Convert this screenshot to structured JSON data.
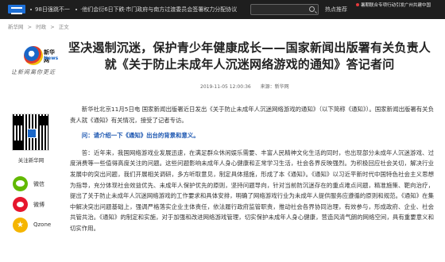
{
  "topbar": {
    "ticker": [
      "98日强跳不一",
      "·他们会衍6日下跌",
      "·市门政府与南方过渡委员会签署权力分配协议"
    ],
    "search_placeholder": "",
    "hot_label": "热点推荐",
    "hot_news": "暑期联合专项行动引发广州共建中国",
    "colors": {
      "bg": "#1e1e1e",
      "brand_blue": "#1d6fd6"
    }
  },
  "breadcrumb": [
    "新华网",
    ">",
    "时政",
    ">",
    "正文"
  ],
  "brand": {
    "name": "新华网",
    "subname": "News",
    "slogan": "让新闻离你更近"
  },
  "article": {
    "title": "坚决遏制沉迷，保护青少年健康成长——国家新闻出版署有关负责人就《关于防止未成年人沉迷网络游戏的通知》答记者问",
    "date": "2019-11-05 12:00:36",
    "source": "来源：新华网",
    "paragraphs": [
      "新华社北京11月5日电 国家新闻出版署近日发出《关于防止未成年人沉迷网络游戏的通知》（以下简称《通知》）。国家新闻出版署有关负责人就《通知》有关情况，接受了记者专访。",
      "问：请介绍一下《通知》出台的背景和意义。",
      "答：近年来，我国网络游戏业发展迅速，在满足群众休闲娱乐需要、丰富人民精神文化生活的同时，也出现部分未成年人沉迷游戏、过度消费等一些值得高度关注的问题。这些问题影响未成年人身心健康和正常学习生活，社会各界反映强烈。为积极回应社会关切，解决行业发展中的突出问题，我们开展相关调研，多方听取意见，制定具体措施，形成了本《通知》。《通知》以习近平新时代中国特色社会主义思想为指导，充分体现社会效益优先、未成年人保护优先的原则，坚持问题导向，针对当前防沉迷存在的重点难点问题，精准施策、靶向治疗，提出了关于防止未成年人沉迷网络游戏的工作要求和具体安排，明确了网络游戏行业为未成年人提供服务应遵循的原则和规范。《通知》在集中解决突出问题基础上，强调严格落实企业主体责任，依法履行政府监管职责，推动社会各界协同治理，有效参与，形成政府、企业、社会共管共治。《通知》的制定和实施，对于加强和改进网络游戏管理，切实保护未成年人身心健康，营造风清气朗的网络空间，具有重要意义和切实作用。"
    ],
    "question_color": "#1a55b0"
  },
  "social": {
    "qr_label": "关注新华网",
    "share": [
      {
        "label": "微信",
        "icon": "wechat-icon",
        "color": "#62b900"
      },
      {
        "label": "微博",
        "icon": "weibo-icon",
        "color": "#e6162d"
      },
      {
        "label": "Qzone",
        "icon": "qzone-icon",
        "color": "#f5b500"
      }
    ]
  }
}
